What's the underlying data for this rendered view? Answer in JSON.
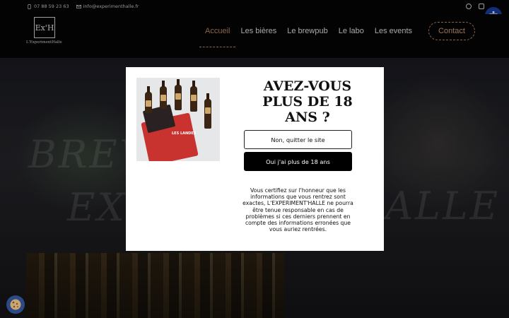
{
  "topbar": {
    "phone": "07 88 59 23 63",
    "email": "info@experimenthalle.fr",
    "social": [
      {
        "name": "facebook-icon"
      },
      {
        "name": "instagram-icon"
      }
    ]
  },
  "header": {
    "logo_mark": "Ex'H",
    "logo_text": "L'ExperimentHalle",
    "nav": [
      {
        "label": "Accueil",
        "active": true
      },
      {
        "label": "Les bières",
        "active": false
      },
      {
        "label": "Le brewpub",
        "active": false
      },
      {
        "label": "Le labo",
        "active": false
      },
      {
        "label": "Les events",
        "active": false
      }
    ],
    "contact_label": "Contact"
  },
  "hero": {
    "word1": "BREW",
    "word2": "EX",
    "word3": "ALLE"
  },
  "modal": {
    "product_brand": "LES LANDES",
    "heading_line1": "AVEZ-VOUS",
    "heading_line2": "PLUS DE 18",
    "heading_line3": "ANS ?",
    "quit_label": "Non, quitter le site",
    "confirm_label": "Oui j'ai plus de 18 ans",
    "disclaimer": "Vous certifiez sur l'honneur que les informations que vous rentrez sont exactes, L'EXPERIMENT'HALLE ne pourra être tenue responsable en cas de problèmes si ces derniers prennent en compte des informations erronées que vous auriez rentrées."
  },
  "colors": {
    "accent": "#c48b63",
    "accessibility": "#1c3fa8",
    "cookie": "#2c4a86"
  }
}
